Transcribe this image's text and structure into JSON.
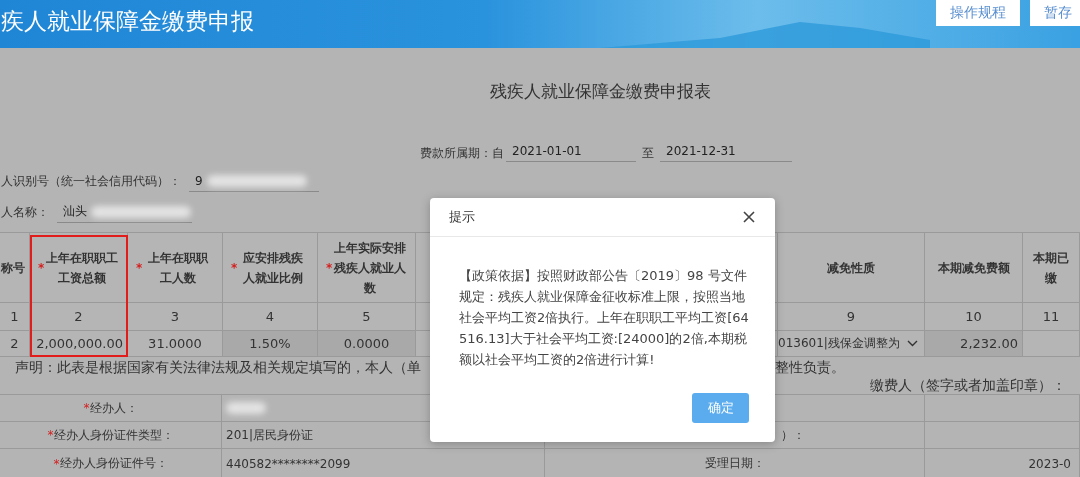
{
  "header": {
    "title": "疾人就业保障金缴费申报",
    "buttons": [
      "操作规程",
      "暂存"
    ]
  },
  "form": {
    "title": "残疾人就业保障金缴费申报表",
    "period_label": "费款所属期：自",
    "period_from": "2021-01-01",
    "period_sep": "至",
    "period_to": "2021-12-31",
    "taxpayer_id": {
      "label": "人识别号（统一社会信用代码）：",
      "value": "9",
      "redacted": true
    },
    "taxpayer_name": {
      "label": "人名称：",
      "value": "汕头",
      "redacted": true
    }
  },
  "table": {
    "columns": [
      {
        "header": "称号",
        "index": "1",
        "value": "2",
        "kind": "text",
        "readonly": false
      },
      {
        "mark": "*",
        "header": "上年在职职工工资总额",
        "highlighted": true,
        "index": "2",
        "value": "2,000,000.00",
        "kind": "amount",
        "readonly": false
      },
      {
        "mark": "*",
        "header": "上年在职职工人数",
        "index": "3",
        "value": "31.0000",
        "kind": "text",
        "readonly": false
      },
      {
        "mark": "*",
        "header": "应安排残疾人就业比例",
        "index": "4",
        "value": "1.50%",
        "kind": "text",
        "readonly": true
      },
      {
        "mark": "*",
        "header": "上年实际安排残疾人就业人数",
        "index": "5",
        "value": "0.0000",
        "kind": "text",
        "readonly": true
      },
      {
        "kind": "hidden"
      },
      {
        "header": "减免性质",
        "index": "9",
        "value": "013601|残保金调整为",
        "kind": "select",
        "readonly": false
      },
      {
        "header": "本期减免费额",
        "index": "10",
        "value": "2,232.00",
        "kind": "amount",
        "readonly": true
      },
      {
        "header": "本期已缴",
        "index": "11",
        "kind": "empty",
        "readonly": false
      }
    ]
  },
  "declaration": {
    "parts": [
      "声明：此表是根据国家有关法律法规及相关规定填写的，本人（单",
      "整性负责。"
    ],
    "signature_label": "缴费人（签字或者加盖印章）："
  },
  "agent_rows": [
    {
      "mark": "*",
      "label": "经办人：",
      "redacted": true
    },
    {
      "mark": "*",
      "label": "经办人身份证件类型：",
      "value": "201|居民身份证",
      "label2": "）："
    },
    {
      "mark": "*",
      "label": "经办人身份证件号：",
      "value": "440582********2099",
      "label2": "受理日期：",
      "value2": "2023-0"
    }
  ],
  "dialog": {
    "title": "提示",
    "body": "【政策依据】按照财政部公告〔2019〕98 号文件规定：残疾人就业保障金征收标准上限，按照当地社会平均工资2倍执行。上年在职职工平均工资[64516.13]大于社会平均工资:[24000]的2倍,本期税额以社会平均工资的2倍进行计算!",
    "confirm": "确定"
  }
}
